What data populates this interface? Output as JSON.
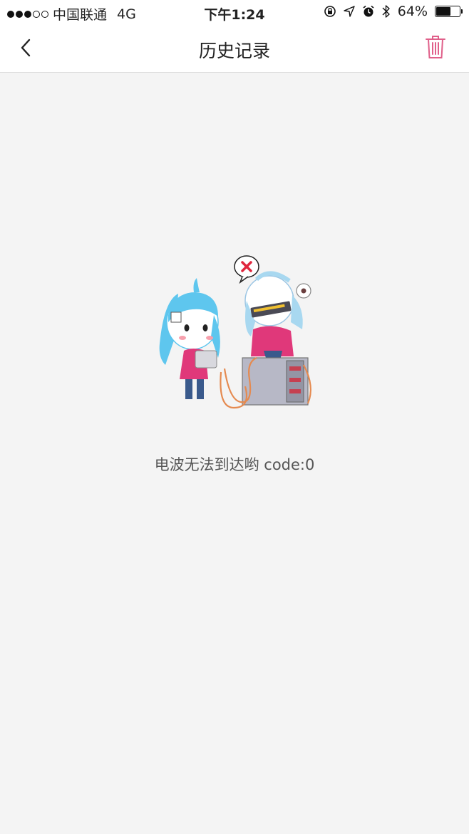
{
  "status_bar": {
    "signal_filled": 3,
    "signal_total": 5,
    "carrier": "中国联通",
    "network": "4G",
    "time": "下午1:24",
    "battery_percent": "64%",
    "battery_level": 0.64,
    "icons": [
      "orientation-lock-icon",
      "location-icon",
      "alarm-icon",
      "bluetooth-icon",
      "battery-icon"
    ]
  },
  "nav": {
    "title": "历史记录",
    "back_icon": "chevron-left-icon",
    "delete_icon": "trash-icon",
    "accent_color": "#e0608a"
  },
  "empty_state": {
    "message": "电波无法到达哟 code:0",
    "illustration": "two-anime-girls-network-error"
  }
}
